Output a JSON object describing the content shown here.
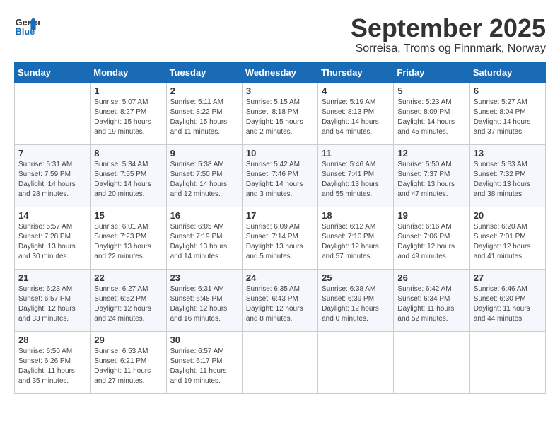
{
  "header": {
    "logo_line1": "General",
    "logo_line2": "Blue",
    "month": "September 2025",
    "location": "Sorreisa, Troms og Finnmark, Norway"
  },
  "days_of_week": [
    "Sunday",
    "Monday",
    "Tuesday",
    "Wednesday",
    "Thursday",
    "Friday",
    "Saturday"
  ],
  "weeks": [
    [
      {
        "day": "",
        "info": ""
      },
      {
        "day": "1",
        "info": "Sunrise: 5:07 AM\nSunset: 8:27 PM\nDaylight: 15 hours\nand 19 minutes."
      },
      {
        "day": "2",
        "info": "Sunrise: 5:11 AM\nSunset: 8:22 PM\nDaylight: 15 hours\nand 11 minutes."
      },
      {
        "day": "3",
        "info": "Sunrise: 5:15 AM\nSunset: 8:18 PM\nDaylight: 15 hours\nand 2 minutes."
      },
      {
        "day": "4",
        "info": "Sunrise: 5:19 AM\nSunset: 8:13 PM\nDaylight: 14 hours\nand 54 minutes."
      },
      {
        "day": "5",
        "info": "Sunrise: 5:23 AM\nSunset: 8:09 PM\nDaylight: 14 hours\nand 45 minutes."
      },
      {
        "day": "6",
        "info": "Sunrise: 5:27 AM\nSunset: 8:04 PM\nDaylight: 14 hours\nand 37 minutes."
      }
    ],
    [
      {
        "day": "7",
        "info": "Sunrise: 5:31 AM\nSunset: 7:59 PM\nDaylight: 14 hours\nand 28 minutes."
      },
      {
        "day": "8",
        "info": "Sunrise: 5:34 AM\nSunset: 7:55 PM\nDaylight: 14 hours\nand 20 minutes."
      },
      {
        "day": "9",
        "info": "Sunrise: 5:38 AM\nSunset: 7:50 PM\nDaylight: 14 hours\nand 12 minutes."
      },
      {
        "day": "10",
        "info": "Sunrise: 5:42 AM\nSunset: 7:46 PM\nDaylight: 14 hours\nand 3 minutes."
      },
      {
        "day": "11",
        "info": "Sunrise: 5:46 AM\nSunset: 7:41 PM\nDaylight: 13 hours\nand 55 minutes."
      },
      {
        "day": "12",
        "info": "Sunrise: 5:50 AM\nSunset: 7:37 PM\nDaylight: 13 hours\nand 47 minutes."
      },
      {
        "day": "13",
        "info": "Sunrise: 5:53 AM\nSunset: 7:32 PM\nDaylight: 13 hours\nand 38 minutes."
      }
    ],
    [
      {
        "day": "14",
        "info": "Sunrise: 5:57 AM\nSunset: 7:28 PM\nDaylight: 13 hours\nand 30 minutes."
      },
      {
        "day": "15",
        "info": "Sunrise: 6:01 AM\nSunset: 7:23 PM\nDaylight: 13 hours\nand 22 minutes."
      },
      {
        "day": "16",
        "info": "Sunrise: 6:05 AM\nSunset: 7:19 PM\nDaylight: 13 hours\nand 14 minutes."
      },
      {
        "day": "17",
        "info": "Sunrise: 6:09 AM\nSunset: 7:14 PM\nDaylight: 13 hours\nand 5 minutes."
      },
      {
        "day": "18",
        "info": "Sunrise: 6:12 AM\nSunset: 7:10 PM\nDaylight: 12 hours\nand 57 minutes."
      },
      {
        "day": "19",
        "info": "Sunrise: 6:16 AM\nSunset: 7:06 PM\nDaylight: 12 hours\nand 49 minutes."
      },
      {
        "day": "20",
        "info": "Sunrise: 6:20 AM\nSunset: 7:01 PM\nDaylight: 12 hours\nand 41 minutes."
      }
    ],
    [
      {
        "day": "21",
        "info": "Sunrise: 6:23 AM\nSunset: 6:57 PM\nDaylight: 12 hours\nand 33 minutes."
      },
      {
        "day": "22",
        "info": "Sunrise: 6:27 AM\nSunset: 6:52 PM\nDaylight: 12 hours\nand 24 minutes."
      },
      {
        "day": "23",
        "info": "Sunrise: 6:31 AM\nSunset: 6:48 PM\nDaylight: 12 hours\nand 16 minutes."
      },
      {
        "day": "24",
        "info": "Sunrise: 6:35 AM\nSunset: 6:43 PM\nDaylight: 12 hours\nand 8 minutes."
      },
      {
        "day": "25",
        "info": "Sunrise: 6:38 AM\nSunset: 6:39 PM\nDaylight: 12 hours\nand 0 minutes."
      },
      {
        "day": "26",
        "info": "Sunrise: 6:42 AM\nSunset: 6:34 PM\nDaylight: 11 hours\nand 52 minutes."
      },
      {
        "day": "27",
        "info": "Sunrise: 6:46 AM\nSunset: 6:30 PM\nDaylight: 11 hours\nand 44 minutes."
      }
    ],
    [
      {
        "day": "28",
        "info": "Sunrise: 6:50 AM\nSunset: 6:26 PM\nDaylight: 11 hours\nand 35 minutes."
      },
      {
        "day": "29",
        "info": "Sunrise: 6:53 AM\nSunset: 6:21 PM\nDaylight: 11 hours\nand 27 minutes."
      },
      {
        "day": "30",
        "info": "Sunrise: 6:57 AM\nSunset: 6:17 PM\nDaylight: 11 hours\nand 19 minutes."
      },
      {
        "day": "",
        "info": ""
      },
      {
        "day": "",
        "info": ""
      },
      {
        "day": "",
        "info": ""
      },
      {
        "day": "",
        "info": ""
      }
    ]
  ]
}
